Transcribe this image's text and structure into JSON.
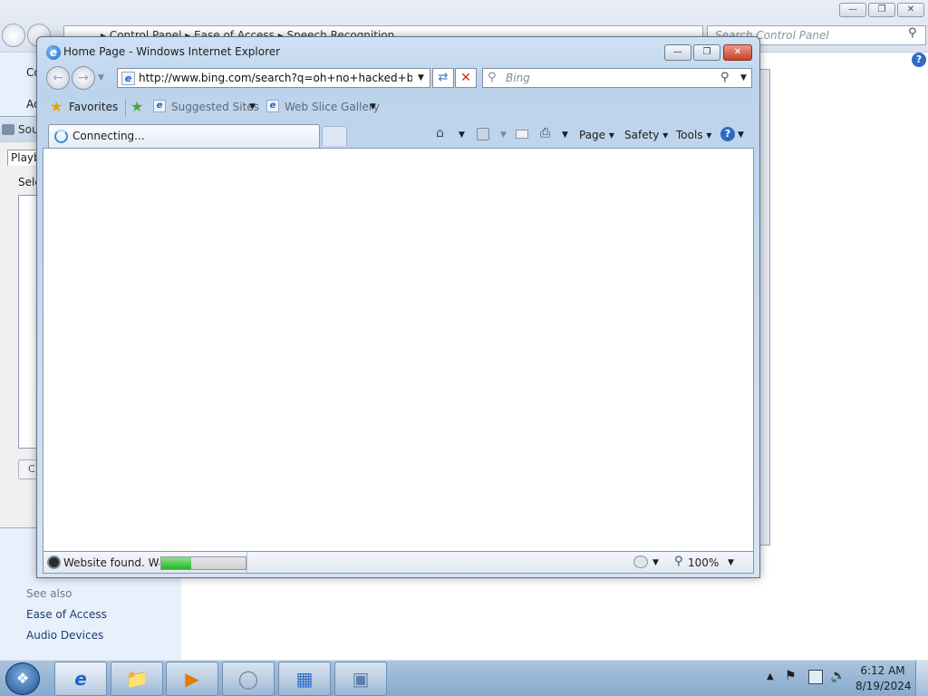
{
  "control_panel": {
    "breadcrumb": "▸  Control Panel  ▸  Ease of Access  ▸  Speech Recognition",
    "search_placeholder": "Search Control Panel",
    "left_co": "Co",
    "left_ac": "Ac",
    "see_also": "See also",
    "links": [
      "Ease of Access",
      "Audio Devices"
    ],
    "window_buttons": {
      "min": "—",
      "max": "❐",
      "close": "✕"
    }
  },
  "sound_dialog": {
    "title": "Sou",
    "tab": "Playb",
    "select_label": "Sele",
    "button": "C"
  },
  "ie": {
    "title": "Home Page - Windows Internet Explorer",
    "window_buttons": {
      "min": "—",
      "max": "❐",
      "close": "✕"
    },
    "address": "http://www.bing.com/search?q=oh+no+hacked+by+hyd",
    "search_placeholder": "Bing",
    "favorites": {
      "label": "Favorites",
      "suggested_sites": "Suggested Sites",
      "web_slice_gallery": "Web Slice Gallery"
    },
    "tab_label": "Connecting...",
    "command_bar": {
      "page": "Page ▾",
      "safety": "Safety ▾",
      "tools": "Tools ▾"
    },
    "status": {
      "text": "Website found. Wai",
      "progress_fraction": 0.35,
      "zoom": "100%"
    }
  },
  "taskbar": {
    "icons": [
      "windows-start-icon",
      "internet-explorer-icon",
      "windows-explorer-icon",
      "media-player-icon",
      "sound-icon",
      "control-panel-icon",
      "app-icon"
    ],
    "time": "6:12 AM",
    "date": "8/19/2024"
  }
}
